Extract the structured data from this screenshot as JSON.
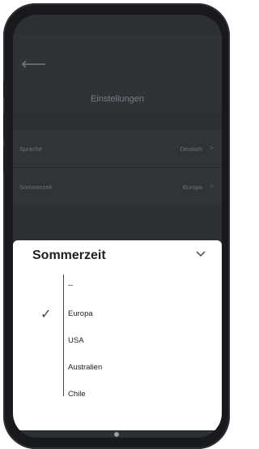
{
  "header": {
    "back_icon": "arrow-left-icon",
    "title": "Einstellungen"
  },
  "settings": [
    {
      "label": "Sprache",
      "value": "Deutsch"
    },
    {
      "label": "Sommerzeit",
      "value": "Europa"
    }
  ],
  "sheet": {
    "title": "Sommerzeit",
    "chevron_icon": "chevron-down-icon",
    "selected": "Europa",
    "options": [
      "--",
      "Europa",
      "USA",
      "Australien",
      "Chile"
    ]
  }
}
